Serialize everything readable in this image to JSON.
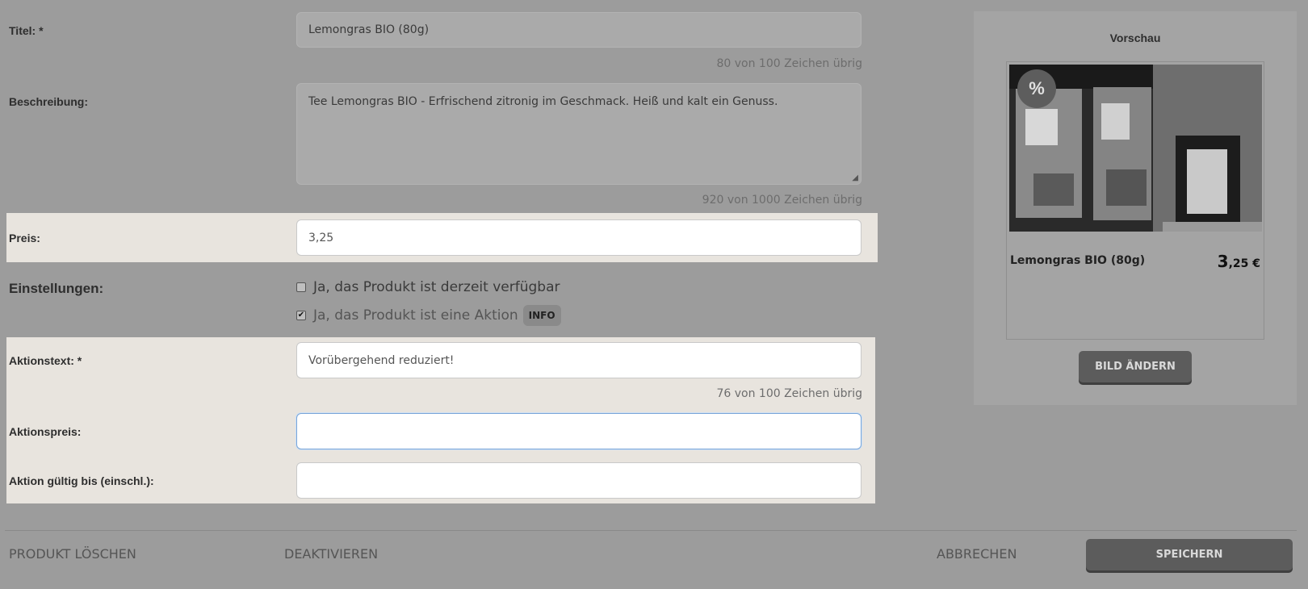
{
  "form": {
    "title_label": "Titel: *",
    "title_value": "Lemongras BIO  (80g)",
    "title_counter": "80 von 100 Zeichen übrig",
    "description_label": "Beschreibung:",
    "description_value": "Tee Lemongras BIO - Erfrischend zitronig im Geschmack. Heiß und kalt ein Genuss.",
    "description_counter": "920 von 1000 Zeichen übrig",
    "price_label": "Preis:",
    "price_value": "3,25",
    "settings_label": "Einstellungen:",
    "available_label": "Ja, das Produkt ist derzeit verfügbar",
    "available_checked": false,
    "promo_label": "Ja, das Produkt ist eine Aktion",
    "promo_checked": true,
    "info_badge": "INFO",
    "promo_text_label": "Aktionstext: *",
    "promo_text_value": "Vorübergehend reduziert!",
    "promo_text_counter": "76 von 100 Zeichen übrig",
    "promo_price_label": "Aktionspreis:",
    "promo_price_value": "",
    "promo_valid_label": "Aktion gültig bis (einschl.):",
    "promo_valid_value": ""
  },
  "preview": {
    "heading": "Vorschau",
    "badge": "%",
    "product_name": "Lemongras BIO (80g)",
    "price_main": "3",
    "price_rest": ",25 €",
    "change_image_button": "BILD ÄNDERN"
  },
  "footer": {
    "delete_button": "PRODUKT LÖSCHEN",
    "deactivate_button": "DEAKTIVIEREN",
    "cancel_button": "ABBRECHEN",
    "save_button": "SPEICHERN"
  }
}
